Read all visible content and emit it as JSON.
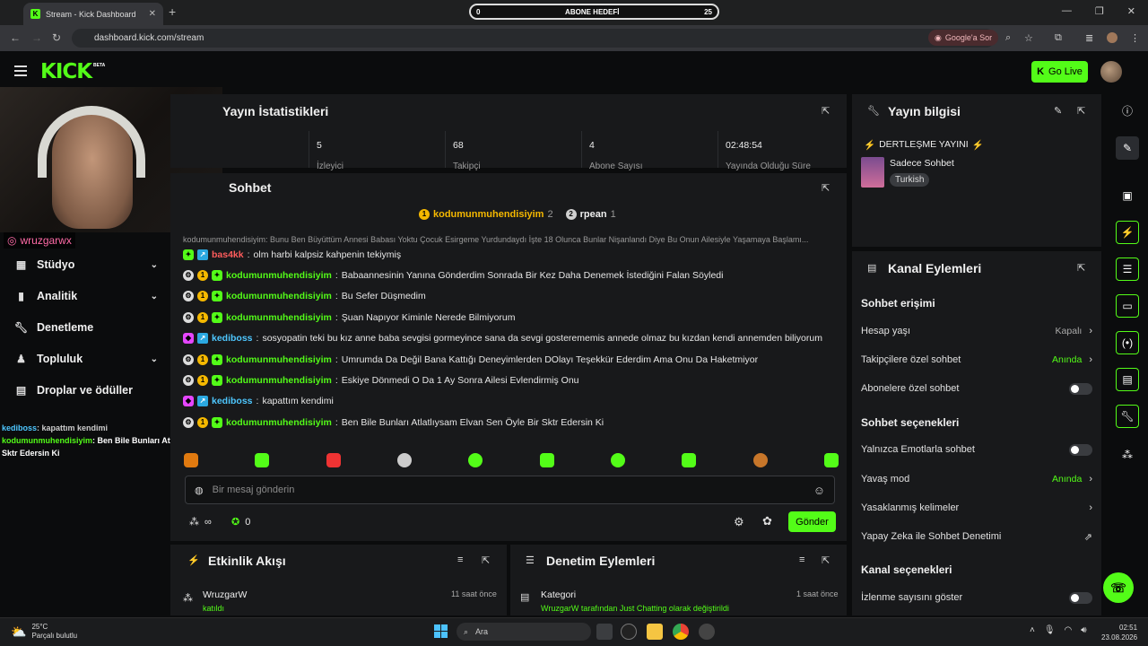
{
  "browser": {
    "tab_title": "Stream - Kick Dashboard",
    "url": "dashboard.kick.com/stream",
    "google_ask": "Google'a Sor"
  },
  "sub_goal": {
    "left": "0",
    "title": "ABONE HEDEFİ",
    "right": "25"
  },
  "header": {
    "logo": "KICK",
    "beta": "BETA",
    "go_live": "Go Live"
  },
  "webcam": {
    "instagram": "wruzgarwx"
  },
  "sidebar": {
    "items": [
      {
        "label": "Stüdyo",
        "has_chevron": true
      },
      {
        "label": "Analitik",
        "has_chevron": true
      },
      {
        "label": "Denetleme",
        "has_chevron": false
      },
      {
        "label": "Topluluk",
        "has_chevron": true
      },
      {
        "label": "Droplar ve ödüller",
        "has_chevron": false
      }
    ]
  },
  "overlay_chat": {
    "line1_user": "kediboss",
    "line1_text": ": kapattım kendimi",
    "line2_user": "kodumunmuhendisiyim",
    "line2_text": ": Ben Bile Bunları Atlatlıysam Elvan Sen Öyle Bir Sktr Edersin Ki"
  },
  "stats": {
    "title": "Yayın İstatistikleri",
    "items": [
      {
        "value": "5",
        "label": "İzleyici"
      },
      {
        "value": "68",
        "label": "Takipçi"
      },
      {
        "value": "4",
        "label": "Abone Sayısı"
      },
      {
        "value": "02:48:54",
        "label": "Yayında Olduğu Süre"
      }
    ]
  },
  "chat": {
    "title": "Sohbet",
    "leaderboard": [
      {
        "rank": "1",
        "name": "kodumunmuhendisiyim",
        "count": "2",
        "color": "#f5b800"
      },
      {
        "rank": "2",
        "name": "rpean",
        "count": "1",
        "color": "#cfcfcf"
      }
    ],
    "pinned": "kodumunmuhendisiyim: Bunu Ben Büyüttüm Annesi Babası Yoktu Çocuk Esirgeme Yurdundaydı İşte 18 Olunca Bunlar Nişanlandı Diye Bu Onun Ailesiyle Yaşamaya Başlamı...",
    "messages": [
      {
        "user": "bas4kk",
        "color": "u-red",
        "text": "olm harbi kalpsiz kahpenin tekiymiş",
        "badges": [
          "og",
          "bot"
        ]
      },
      {
        "user": "kodumunmuhendisiyim",
        "color": "u-green",
        "text": "Babaannesinin Yanına Gönderdim Sonrada Bir Kez Daha Denemek İstediğini Falan Söyledi",
        "badges": [
          "mod",
          "sub",
          "og"
        ]
      },
      {
        "user": "kodumunmuhendisiyim",
        "color": "u-green",
        "text": "Bu Sefer Düşmedim",
        "badges": [
          "mod",
          "sub",
          "og"
        ]
      },
      {
        "user": "kodumunmuhendisiyim",
        "color": "u-green",
        "text": "Şuan Napıyor Kiminle Nerede Bilmiyorum",
        "badges": [
          "mod",
          "sub",
          "og"
        ]
      },
      {
        "user": "kediboss",
        "color": "u-blue",
        "text": "sosyopatin teki bu kız anne baba sevgisi gormeyince sana da sevgi gosterememis annede olmaz bu kızdan kendi annemden biliyorum",
        "badges": [
          "vip",
          "bot"
        ]
      },
      {
        "user": "kodumunmuhendisiyim",
        "color": "u-green",
        "text": "Umrumda Da Değil Bana Kattığı Deneyimlerden DOlayı Teşekkür Ederdim Ama Onu Da Haketmiyor",
        "badges": [
          "mod",
          "sub",
          "og"
        ]
      },
      {
        "user": "kodumunmuhendisiyim",
        "color": "u-green",
        "text": "Eskiye Dönmedi O Da 1 Ay Sonra Ailesi Evlendirmiş Onu",
        "badges": [
          "mod",
          "sub",
          "og"
        ]
      },
      {
        "user": "kediboss",
        "color": "u-blue",
        "text": "kapattım kendimi",
        "badges": [
          "vip",
          "bot"
        ]
      },
      {
        "user": "kodumunmuhendisiyim",
        "color": "u-green",
        "text": "Ben Bile Bunları Atlatlıysam Elvan Sen Öyle Bir Sktr Edersin Ki",
        "badges": [
          "mod",
          "sub",
          "og"
        ]
      }
    ],
    "input_placeholder": "Bir mesaj gönderin",
    "points": "∞",
    "coins": "0",
    "send": "Gönder"
  },
  "activity": {
    "title": "Etkinlik Akışı",
    "item_name": "WruzgarW",
    "item_time": "11 saat önce",
    "item_sub": "katıldı"
  },
  "moderation": {
    "title": "Denetim Eylemleri",
    "item_name": "Kategori",
    "item_time": "1 saat önce",
    "item_sub": "WruzgarW tarafından Just Chatting olarak değiştirildi"
  },
  "stream_info": {
    "title": "Yayın bilgisi",
    "stream_title": "DERTLEŞME YAYINI",
    "category": "Sadece Sohbet",
    "language": "Turkish"
  },
  "channel_actions": {
    "title": "Kanal Eylemleri",
    "chat_access": "Sohbet erişimi",
    "account_age": "Hesap yaşı",
    "account_age_val": "Kapalı",
    "followers_only": "Takipçilere özel sohbet",
    "followers_only_val": "Anında",
    "subs_only": "Abonelere özel sohbet",
    "chat_options": "Sohbet seçenekleri",
    "emote_only": "Yalnızca Emotlarla sohbet",
    "slow_mode": "Yavaş mod",
    "slow_mode_val": "Anında",
    "banned_words": "Yasaklanmış kelimeler",
    "ai_moderation": "Yapay Zeka ile Sohbet Denetimi",
    "channel_options": "Kanal seçenekleri",
    "show_viewers": "İzlenme sayısını göster"
  },
  "taskbar": {
    "temp": "25°C",
    "weather": "Parçalı bulutlu",
    "search": "Ara",
    "time": "02:51",
    "date": "23.08.2026"
  }
}
